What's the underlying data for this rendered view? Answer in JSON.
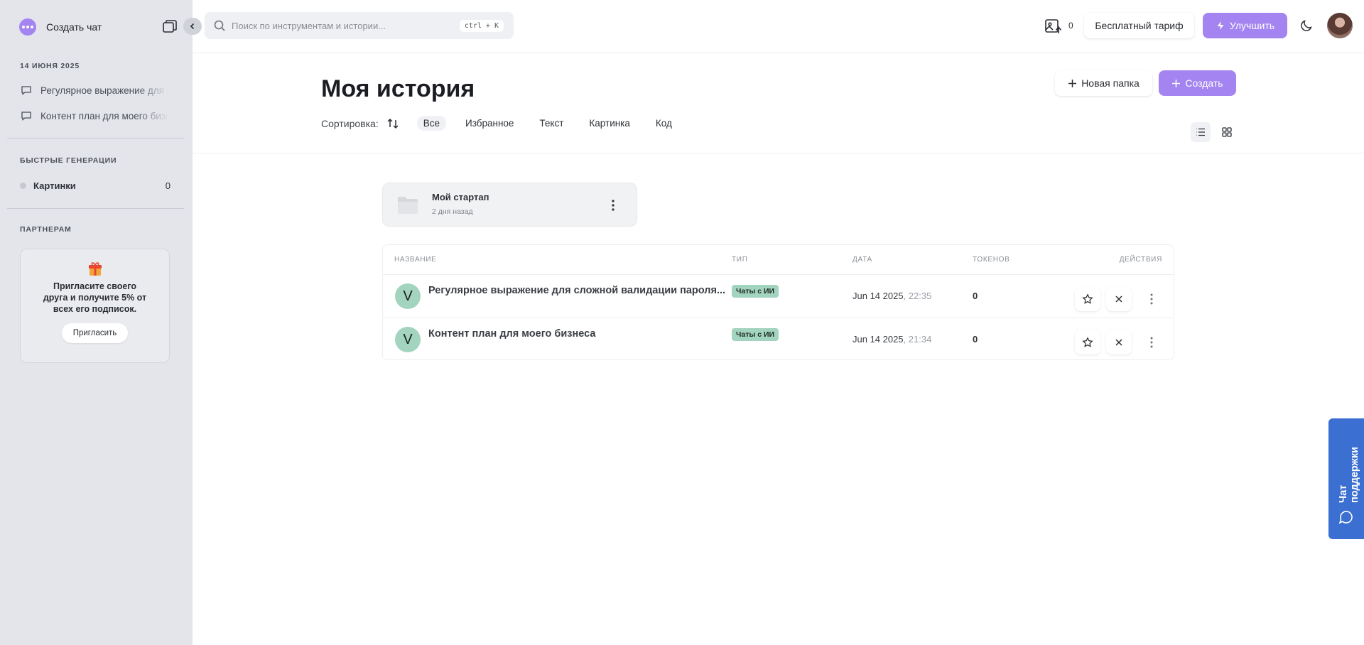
{
  "sidebar": {
    "create_chat_label": "Создать чат",
    "date_heading": "14 июня 2025",
    "history": [
      {
        "label": "Регулярное выражение для сложной валидации пароля"
      },
      {
        "label": "Контент план для моего бизнеса"
      }
    ],
    "quick_heading": "Быстрые генерации",
    "quick_item": {
      "label": "Картинки",
      "count": "0"
    },
    "partners_heading": "Партнерам",
    "partner_text": "Пригласите своего друга и получите 5% от всех его подписок.",
    "invite_label": "Пригласить"
  },
  "header": {
    "search_placeholder": "Поиск по инструментам и истории...",
    "shortcut": "ctrl + K",
    "images_count": "0",
    "tariff_label": "Бесплатный тариф",
    "upgrade_label": "Улучшить"
  },
  "page": {
    "title": "Моя история",
    "new_folder_label": "Новая папка",
    "create_label": "Создать",
    "sort_label": "Сортировка:",
    "filters": [
      "Все",
      "Избранное",
      "Текст",
      "Картинка",
      "Код"
    ],
    "active_filter": "Все"
  },
  "folder": {
    "name": "Мой стартап",
    "time": "2 дня назад"
  },
  "table": {
    "headers": {
      "name": "Название",
      "type": "Тип",
      "date": "Дата",
      "tokens": "Токенов",
      "actions": "Действия"
    },
    "rows": [
      {
        "avatar": "V",
        "title": "Регулярное выражение для сложной валидации пароля...",
        "badge": "Чаты с ИИ",
        "date": "Jun 14 2025",
        "time": ", 22:35",
        "tokens": "0"
      },
      {
        "avatar": "V",
        "title": "Контент план для моего бизнеса",
        "badge": "Чаты с ИИ",
        "date": "Jun 14 2025",
        "time": ", 21:34",
        "tokens": "0"
      }
    ]
  },
  "support": {
    "label": "Чат поддержки"
  },
  "colors": {
    "accent": "#a484f1",
    "badge": "#a3d4bf",
    "support": "#3b6fd1",
    "sidebar": "#e3e5ea"
  }
}
